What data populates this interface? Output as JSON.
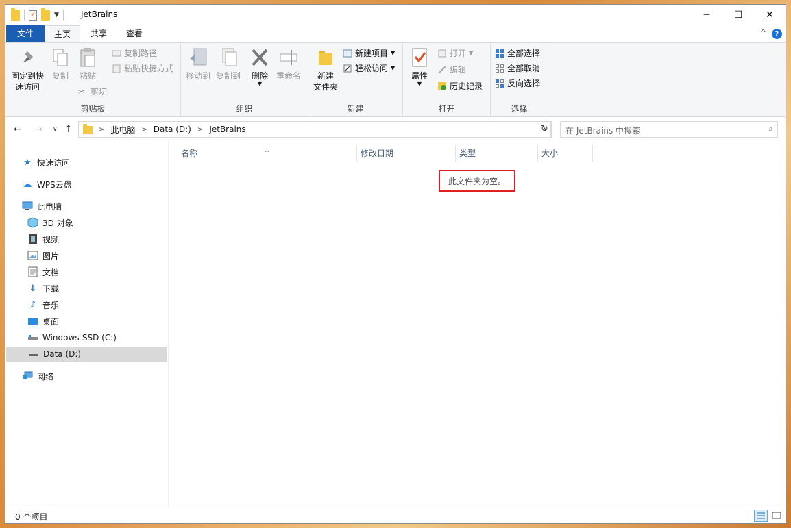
{
  "window": {
    "title": "JetBrains"
  },
  "ribbon_tabs": {
    "file": "文件",
    "home": "主页",
    "share": "共享",
    "view": "查看"
  },
  "clipboard": {
    "pin": [
      "固定到快",
      "速访问"
    ],
    "copy": "复制",
    "paste": "粘贴",
    "copy_path": "复制路径",
    "paste_shortcut": "粘贴快捷方式",
    "cut": "剪切",
    "label": "剪贴板"
  },
  "organize": {
    "move_to": "移动到",
    "copy_to": "复制到",
    "delete": "删除",
    "rename": "重命名",
    "label": "组织"
  },
  "new": {
    "new_folder": [
      "新建",
      "文件夹"
    ],
    "new_item": "新建项目",
    "easy_access": "轻松访问",
    "label": "新建"
  },
  "open": {
    "properties": "属性",
    "open": "打开",
    "edit": "编辑",
    "history": "历史记录",
    "label": "打开"
  },
  "select": {
    "select_all": "全部选择",
    "select_none": "全部取消",
    "invert": "反向选择",
    "label": "选择"
  },
  "address": {
    "crumbs": [
      "此电脑",
      "Data (D:)",
      "JetBrains"
    ],
    "search_placeholder": "在 JetBrains 中搜索"
  },
  "nav": {
    "quick_access": "快速访问",
    "wps_cloud": "WPS云盘",
    "this_pc": "此电脑",
    "objects3d": "3D 对象",
    "videos": "视频",
    "pictures": "图片",
    "documents": "文档",
    "downloads": "下载",
    "music": "音乐",
    "desktop": "桌面",
    "drive_c": "Windows-SSD (C:)",
    "drive_d": "Data (D:)",
    "network": "网络"
  },
  "columns": {
    "name": "名称",
    "modified": "修改日期",
    "type": "类型",
    "size": "大小"
  },
  "empty_message": "此文件夹为空。",
  "status": {
    "count": "0 个项目"
  },
  "colors": {
    "file_tab": "#1a5fb4",
    "highlight_box": "#e02020",
    "folder": "#f5c842"
  }
}
